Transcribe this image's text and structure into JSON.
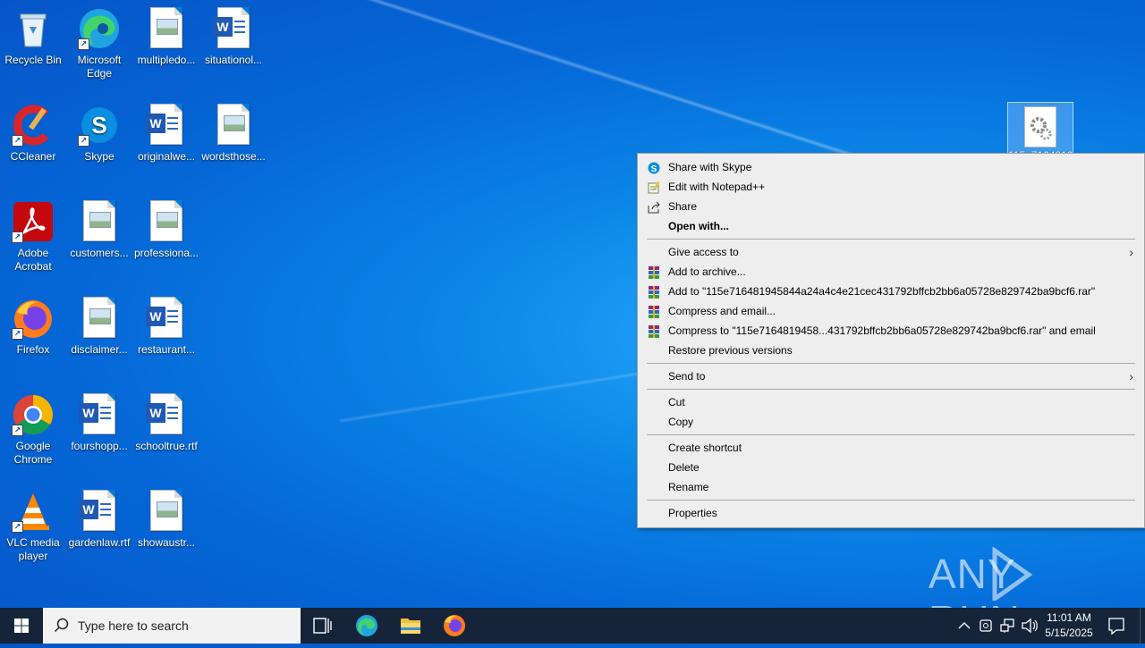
{
  "desktop": {
    "icons": [
      {
        "label": "Recycle Bin"
      },
      {
        "label": "Microsoft Edge"
      },
      {
        "label": "multipledo..."
      },
      {
        "label": "situationol..."
      },
      {
        "label": "CCleaner"
      },
      {
        "label": "Skype"
      },
      {
        "label": "originalwe..."
      },
      {
        "label": "wordsthose..."
      },
      {
        "label": "Adobe Acrobat"
      },
      {
        "label": "customers..."
      },
      {
        "label": "professiona..."
      },
      {
        "label": "Firefox"
      },
      {
        "label": "disclaimer..."
      },
      {
        "label": "restaurant..."
      },
      {
        "label": "Google Chrome"
      },
      {
        "label": "fourshopp..."
      },
      {
        "label": "schooltrue.rtf"
      },
      {
        "label": "VLC media player"
      },
      {
        "label": "gardenlaw.rtf"
      },
      {
        "label": "showaustr..."
      }
    ],
    "selected_file_label": "115e7164819..."
  },
  "context_menu": {
    "share_skype": "Share with Skype",
    "edit_notepad": "Edit with Notepad++",
    "share": "Share",
    "open_with": "Open with...",
    "give_access": "Give access to",
    "add_archive": "Add to archive...",
    "add_to_rar": "Add to \"115e716481945844a24a4c4e21cec431792bffcb2bb6a05728e829742ba9bcf6.rar\"",
    "compress_email": "Compress and email...",
    "compress_to_rar_email": "Compress to \"115e7164819458...431792bffcb2bb6a05728e829742ba9bcf6.rar\" and email",
    "restore_versions": "Restore previous versions",
    "send_to": "Send to",
    "cut": "Cut",
    "copy": "Copy",
    "create_shortcut": "Create shortcut",
    "delete": "Delete",
    "rename": "Rename",
    "properties": "Properties"
  },
  "watermark": {
    "text": "ANY RUN"
  },
  "taskbar": {
    "search_placeholder": "Type here to search",
    "time": "11:01 AM",
    "date": "5/15/2025"
  },
  "colors": {
    "taskbar": "#16243a",
    "menu_bg": "#eeeeee",
    "desktop_blue": "#0778d8"
  }
}
